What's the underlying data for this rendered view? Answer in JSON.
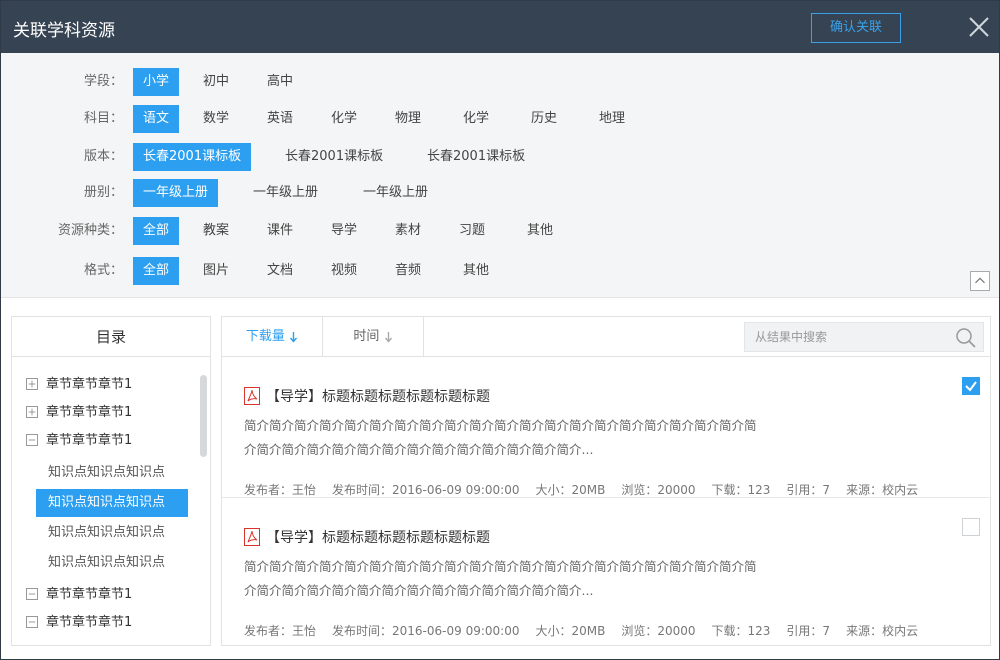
{
  "dialog": {
    "title": "关联学科资源",
    "confirm_label": "确认关联"
  },
  "filters": {
    "stage": {
      "label": "学段：",
      "options": [
        "小学",
        "初中",
        "高中"
      ],
      "selected": 0
    },
    "subject": {
      "label": "科目：",
      "options": [
        "语文",
        "数学",
        "英语",
        "化学",
        "物理",
        "化学",
        "历史",
        "地理"
      ],
      "selected": 0
    },
    "edition": {
      "label": "版本：",
      "options": [
        "长春2001课标板",
        "长春2001课标板",
        "长春2001课标板"
      ],
      "selected": 0
    },
    "volume": {
      "label": "册别：",
      "options": [
        "一年级上册",
        "一年级上册",
        "一年级上册"
      ],
      "selected": 0
    },
    "resource_type": {
      "label": "资源种类：",
      "options": [
        "全部",
        "教案",
        "课件",
        "导学",
        "素材",
        "习题",
        "其他"
      ],
      "selected": 0
    },
    "format": {
      "label": "格式：",
      "options": [
        "全部",
        "图片",
        "文档",
        "视频",
        "音频",
        "其他"
      ],
      "selected": 0
    }
  },
  "toc": {
    "title": "目录",
    "chapters_top": [
      "章节章节章节1",
      "章节章节章节1",
      "章节章节章节1"
    ],
    "knowledge_points": [
      "知识点知识点知识点",
      "知识点知识点知识点",
      "知识点知识点知识点",
      "知识点知识点知识点"
    ],
    "knowledge_selected": 1,
    "chapters_bottom": [
      "章节章节章节1",
      "章节章节章节1"
    ]
  },
  "results_panel": {
    "sort_downloads": "下载量",
    "sort_time": "时间",
    "search_placeholder": "从结果中搜索",
    "items": [
      {
        "title": "【导学】标题标题标题标题标题标题",
        "desc": "简介简介简介简介简介简介简介简介简介简介简介简介简介简介简介简介简介简介简介简介简介简介简介简介简介简介简介简介简介简介简介简介简介简介...",
        "publisher": "发布者：王怡",
        "time": "发布时间：2016-06-09 09:00:00",
        "size": "大小：20MB",
        "views": "浏览：20000",
        "downloads": "下载：123",
        "cites": "引用：7",
        "source": "来源：校内云",
        "checked": true
      },
      {
        "title": "【导学】标题标题标题标题标题标题",
        "desc": "简介简介简介简介简介简介简介简介简介简介简介简介简介简介简介简介简介简介简介简介简介简介简介简介简介简介简介简介简介简介简介简介简介简介...",
        "publisher": "发布者：王怡",
        "time": "发布时间：2016-06-09 09:00:00",
        "size": "大小：20MB",
        "views": "浏览：20000",
        "downloads": "下载：123",
        "cites": "引用：7",
        "source": "来源：校内云",
        "checked": false
      }
    ]
  },
  "colors": {
    "accent": "#2d9ff0",
    "titlebar": "#354352",
    "pdf": "#d9342b"
  }
}
